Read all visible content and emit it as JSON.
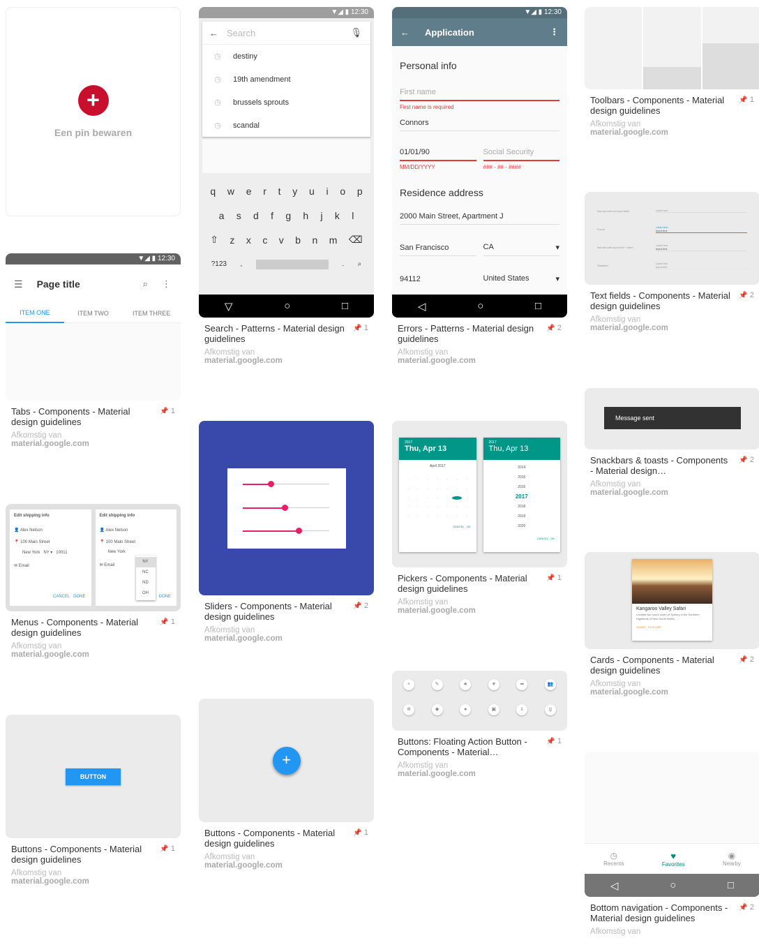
{
  "save_pin": {
    "label": "Een pin bewaren",
    "icon": "plus-icon"
  },
  "pins": [
    {
      "title": "Tabs - Components - Material design guidelines",
      "count": "1",
      "source_prefix": "Afkomstig van",
      "source_domain": "material.google.com"
    },
    {
      "title": "Menus - Components - Material design guidelines",
      "count": "1",
      "source_prefix": "Afkomstig van",
      "source_domain": "material.google.com"
    },
    {
      "title": "Buttons - Components - Material design guidelines",
      "count": "1",
      "source_prefix": "Afkomstig van",
      "source_domain": "material.google.com"
    },
    {
      "title": "Search - Patterns - Material design guidelines",
      "count": "1",
      "source_prefix": "Afkomstig van",
      "source_domain": "material.google.com"
    },
    {
      "title": "Sliders - Components - Material design guidelines",
      "count": "2",
      "source_prefix": "Afkomstig van",
      "source_domain": "material.google.com"
    },
    {
      "title": "Buttons - Components - Material design guidelines",
      "count": "1",
      "source_prefix": "Afkomstig van",
      "source_domain": "material.google.com"
    },
    {
      "title": "Errors - Patterns - Material design guidelines",
      "count": "2",
      "source_prefix": "Afkomstig van",
      "source_domain": "material.google.com"
    },
    {
      "title": "Pickers - Components - Material design guidelines",
      "count": "1",
      "source_prefix": "Afkomstig van",
      "source_domain": "material.google.com"
    },
    {
      "title": "Buttons: Floating Action Button - Components - Material…",
      "count": "1",
      "source_prefix": "Afkomstig van",
      "source_domain": "material.google.com"
    },
    {
      "title": "Toolbars - Components - Material design guidelines",
      "count": "1",
      "source_prefix": "Afkomstig van",
      "source_domain": "material.google.com"
    },
    {
      "title": "Text fields - Components - Material design guidelines",
      "count": "2",
      "source_prefix": "Afkomstig van",
      "source_domain": "material.google.com"
    },
    {
      "title": "Snackbars & toasts - Components - Material design…",
      "count": "2",
      "source_prefix": "Afkomstig van",
      "source_domain": "material.google.com"
    },
    {
      "title": "Cards - Components - Material design guidelines",
      "count": "2",
      "source_prefix": "Afkomstig van",
      "source_domain": "material.google.com"
    },
    {
      "title": "Bottom navigation - Components - Material design guidelines",
      "count": "2",
      "source_prefix": "Afkomstig van",
      "source_domain": ""
    }
  ],
  "shots": {
    "status_time": "12:30",
    "tabs": {
      "title": "Page title",
      "tab1": "ITEM ONE",
      "tab2": "ITEM TWO",
      "tab3": "ITEM THREE"
    },
    "menus": {
      "header": "Edit shipping info",
      "name": "Alex Nelson",
      "street": "100 Main Street",
      "city": "New York",
      "state": "NY",
      "zip": "10011",
      "email": "Email",
      "cancel": "CANCEL",
      "done": "DONE",
      "opt1": "NY",
      "opt2": "NC",
      "opt3": "ND",
      "opt4": "OH"
    },
    "button": {
      "label": "BUTTON"
    },
    "search": {
      "placeholder": "Search",
      "s1": "destiny",
      "s2": "19th amendment",
      "s3": "brussels sprouts",
      "s4": "scandal",
      "row1": [
        "q",
        "w",
        "e",
        "r",
        "t",
        "y",
        "u",
        "i",
        "o",
        "p"
      ],
      "row2": [
        "a",
        "s",
        "d",
        "f",
        "g",
        "h",
        "j",
        "k",
        "l"
      ],
      "row3": [
        "z",
        "x",
        "c",
        "v",
        "b",
        "n",
        "m"
      ],
      "sym": "?123",
      "comma": ",",
      "dot": "."
    },
    "errors": {
      "appbar": "Application",
      "section1": "Personal info",
      "first_name": "First name",
      "first_error": "First name is required",
      "last": "Connors",
      "date": "01/01/90",
      "date_hint": "MM/DD/YYYY",
      "ssn": "Social Security",
      "ssn_hint": "### - ## - ####",
      "section2": "Residence address",
      "street": "2000 Main Street, Apartment J",
      "city": "San Francisco",
      "state": "CA",
      "zip": "94112",
      "country": "United States"
    },
    "pickers": {
      "year": "2017",
      "date": "Thu, Apr 13",
      "month": "April 2017",
      "years": [
        "2014",
        "2015",
        "2016",
        "2017",
        "2018",
        "2019",
        "2020"
      ],
      "cancel": "CANCEL",
      "ok": "OK"
    },
    "snackbar": {
      "text": "Message sent"
    },
    "cards": {
      "title": "Kangaroo Valley Safari",
      "sub": "Located two hours south of Sydney in the Southern Highlands of New South Wales, ...",
      "share": "SHARE",
      "explore": "EXPLORE"
    },
    "bottomnav": {
      "recents": "Recents",
      "favorites": "Favorites",
      "nearby": "Nearby"
    },
    "textfields": {
      "l1": "Normal with text and label",
      "l2": "Focus",
      "l3": "Normal with input text + label",
      "l4": "Disabled",
      "label": "Label text",
      "input": "Input text"
    }
  }
}
